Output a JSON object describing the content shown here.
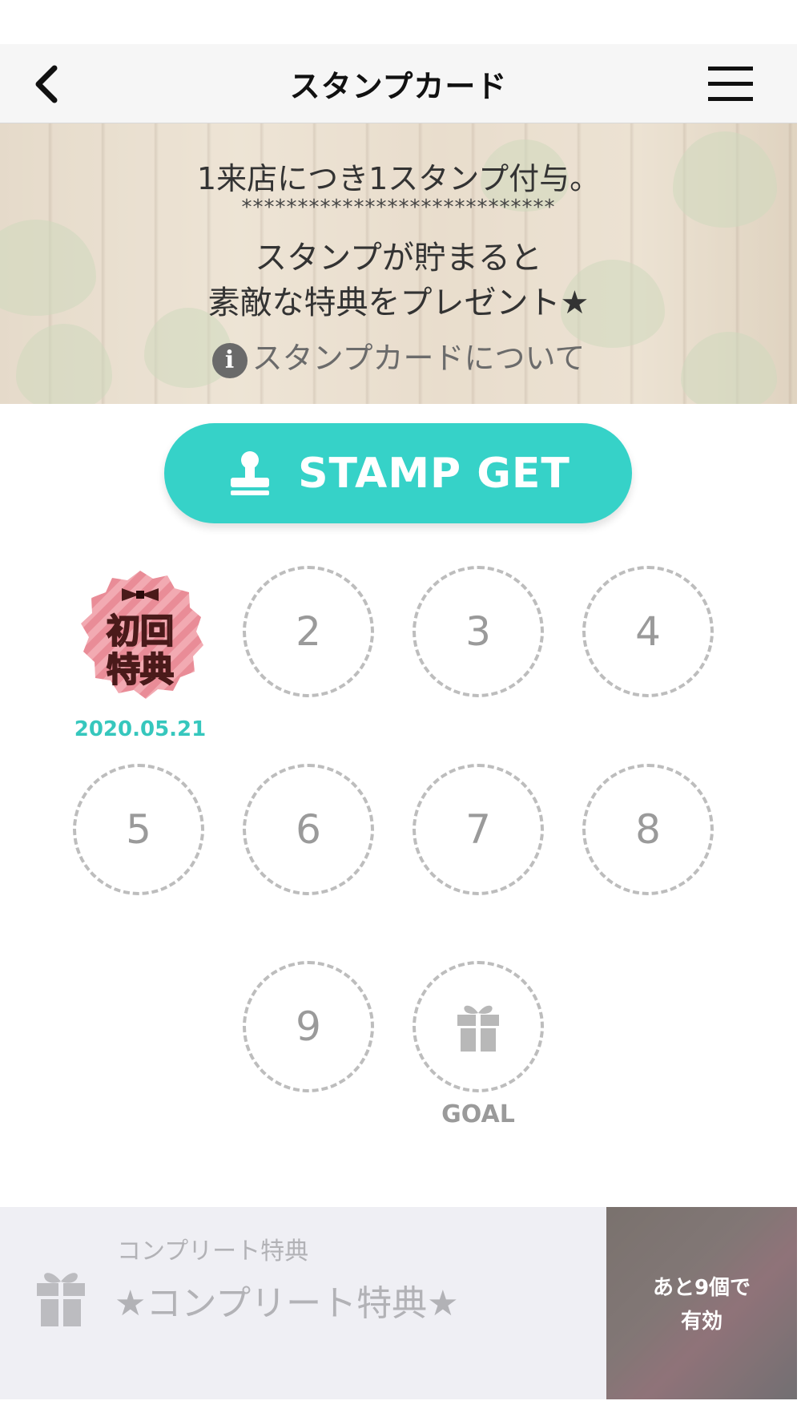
{
  "header": {
    "title": "スタンプカード",
    "back_icon": "chevron-left-icon",
    "menu_icon": "hamburger-menu-icon"
  },
  "banner": {
    "line1": "1来店につき1スタンプ付与。",
    "stars": "****************************",
    "line2a": "スタンプが貯まると",
    "line2b": "素敵な特典をプレゼント★",
    "info_link": "スタンプカードについて",
    "info_icon": "info-icon"
  },
  "stamp_get": {
    "label": "STAMP GET",
    "icon": "stamp-icon",
    "color": "#36d2c8"
  },
  "stamps": {
    "first": {
      "badge_line1": "初回",
      "badge_line2": "特典",
      "date": "2020.05.21"
    },
    "slots": [
      "2",
      "3",
      "4",
      "5",
      "6",
      "7",
      "8",
      "9"
    ],
    "goal_label": "GOAL",
    "goal_icon": "gift-icon"
  },
  "bottom": {
    "sub_label": "コンプリート特典",
    "main_label": "★コンプリート特典★",
    "icon": "gift-icon",
    "remaining_line1": "あと9個で",
    "remaining_line2": "有効"
  }
}
